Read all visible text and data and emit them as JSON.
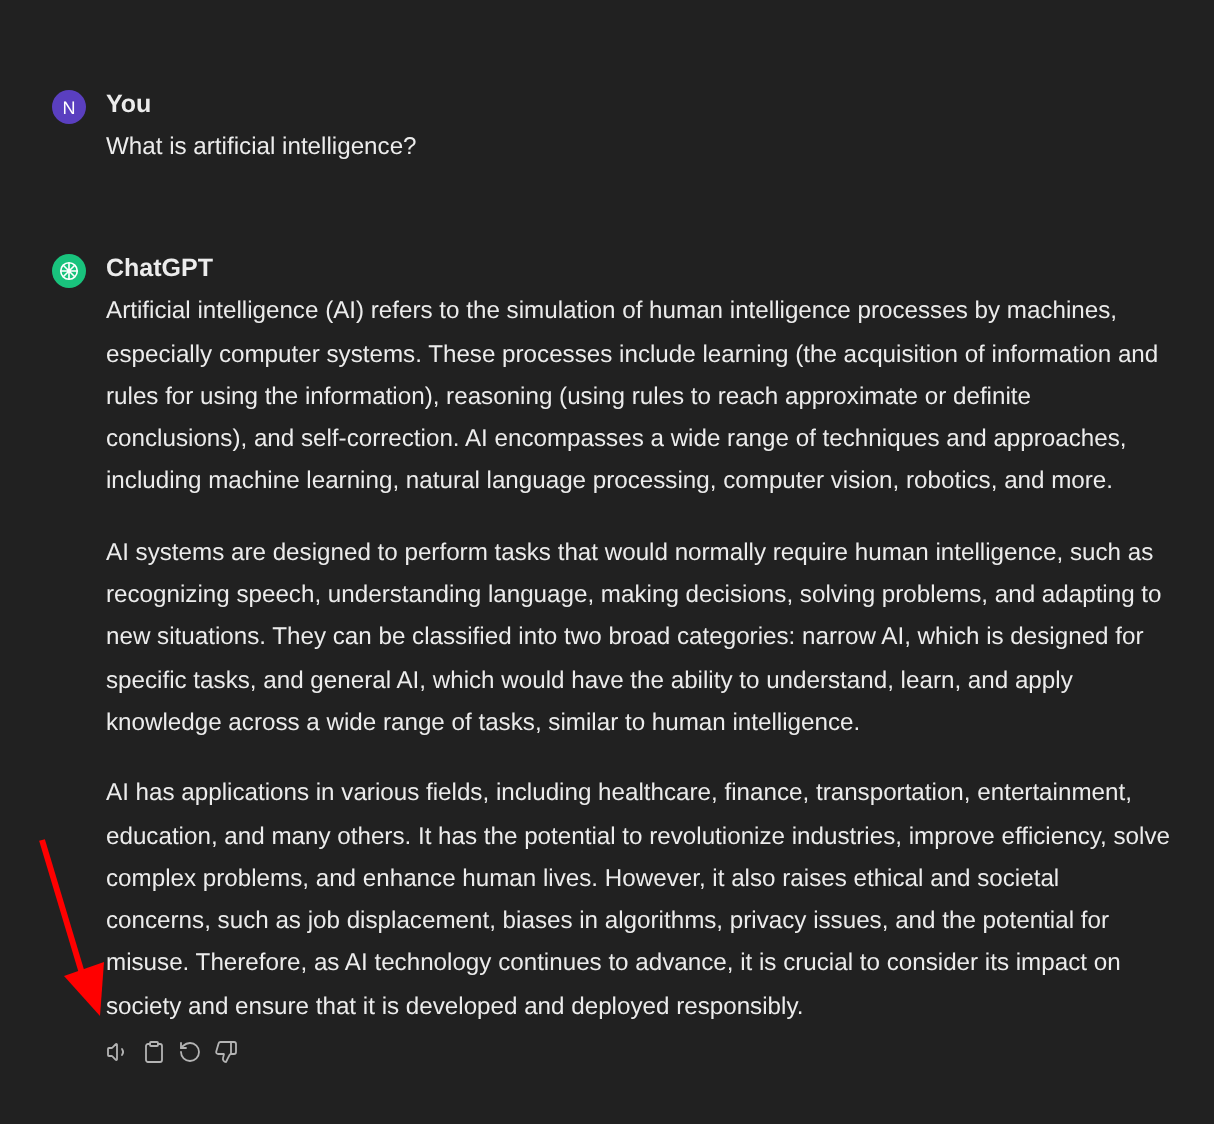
{
  "messages": [
    {
      "kind": "user",
      "author": "You",
      "avatar_letter": "N",
      "paragraphs": [
        "What is artificial intelligence?"
      ]
    },
    {
      "kind": "assistant",
      "author": "ChatGPT",
      "paragraphs": [
        "Artificial intelligence (AI) refers to the simulation of human intelligence processes by machines, especially computer systems. These processes include learning (the acquisition of information and rules for using the information), reasoning (using rules to reach approximate or definite conclusions), and self-correction. AI encompasses a wide range of techniques and approaches, including machine learning, natural language processing, computer vision, robotics, and more.",
        "AI systems are designed to perform tasks that would normally require human intelligence, such as recognizing speech, understanding language, making decisions, solving problems, and adapting to new situations. They can be classified into two broad categories: narrow AI, which is designed for specific tasks, and general AI, which would have the ability to understand, learn, and apply knowledge across a wide range of tasks, similar to human intelligence.",
        "AI has applications in various fields, including healthcare, finance, transportation, entertainment, education, and many others. It has the potential to revolutionize industries, improve efficiency, solve complex problems, and enhance human lives. However, it also raises ethical and societal concerns, such as job displacement, biases in algorithms, privacy issues, and the potential for misuse. Therefore, as AI technology continues to advance, it is crucial to consider its impact on society and ensure that it is developed and deployed responsibly."
      ]
    }
  ]
}
